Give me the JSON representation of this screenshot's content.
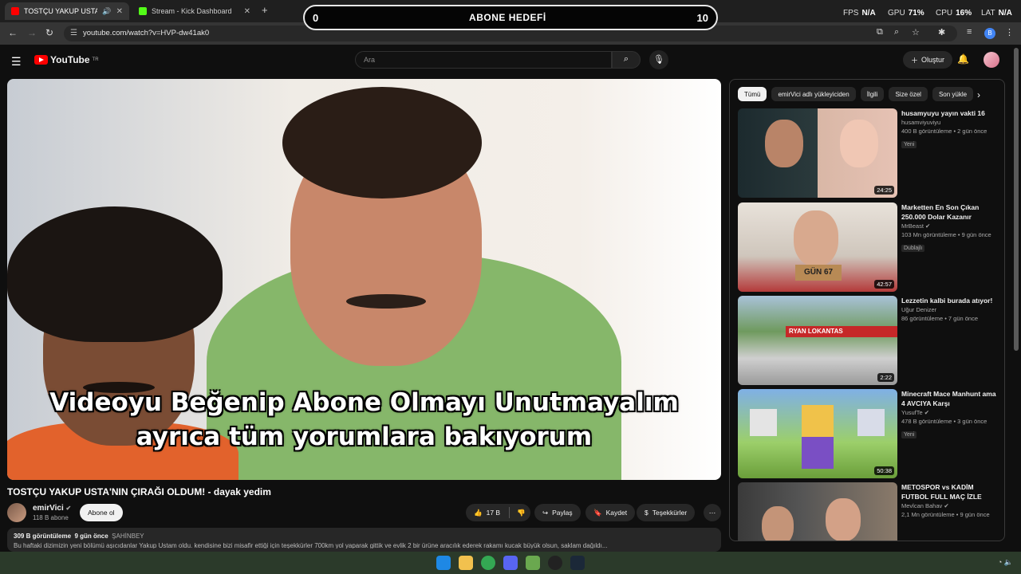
{
  "browser": {
    "tabs": [
      {
        "title": "TOSTÇU YAKUP USTA'NIN Ç",
        "active": true,
        "favicon_color": "#ff0000"
      },
      {
        "title": "Stream - Kick Dashboard",
        "active": false,
        "favicon_color": "#53fc18"
      }
    ],
    "url": "youtube.com/watch?v=HVP-dw41ak0",
    "profile_initial": "B"
  },
  "overlay": {
    "left_count": "0",
    "title": "ABONE HEDEFİ",
    "right_count": "10"
  },
  "stats": {
    "fps_label": "FPS",
    "fps_value": "N/A",
    "gpu_label": "GPU",
    "gpu_value": "71%",
    "cpu_label": "CPU",
    "cpu_value": "16%",
    "lat_label": "LAT",
    "lat_value": "N/A"
  },
  "youtube": {
    "logo_text": "YouTube",
    "region": "TR",
    "search_placeholder": "Ara",
    "create_label": "Oluştur"
  },
  "video": {
    "caption_line1": "Videoyu Beğenip Abone Olmayı Unutmayalım",
    "caption_line2": "ayrıca tüm yorumlara bakıyorum",
    "title": "TOSTÇU YAKUP USTA'NIN ÇIRAĞI OLDUM! - dayak yedim",
    "channel": "emirVici",
    "subscribers": "118 B abone",
    "subscribe_label": "Abone ol",
    "likes": "17 B",
    "share_label": "Paylaş",
    "save_label": "Kaydet",
    "thanks_label": "Teşekkürler",
    "views": "309 B görüntüleme",
    "age": "9 gün önce",
    "tag": "ŞAHİNBEY",
    "description": "Bu haftaki dizimizin yeni bölümü aşıcıdanlar Yakup Ustam oldu. kendisine bizi misafir ettiği için teşekkürler 700km yol yaparak gittik ve evlik 2 bir ürüne aracılık ederek rakamı kucak büyük olsun, saklam dağıldı..."
  },
  "chips": [
    "Tümü",
    "emirVici adlı yükleyiciden",
    "İlgili",
    "Size özel",
    "Son yükle"
  ],
  "recommendations": [
    {
      "title": "husamyuyu yayın vakti 16",
      "channel": "husamviyuviyu",
      "meta": "400 B görüntüleme • 2 gün önce",
      "badge": "Yeni",
      "duration": "24:25"
    },
    {
      "title": "Marketten En Son Çıkan 250.000 Dolar Kazanır",
      "channel": "MrBeast",
      "meta": "103 Mn görüntüleme • 9 gün önce",
      "badge": "Dublajlı",
      "duration": "42:57"
    },
    {
      "title": "Lezzetin kalbi burada atıyor!",
      "channel": "Uğur Denizer",
      "meta": "86 görüntüleme • 7 gün önce",
      "badge": "",
      "duration": "2:22"
    },
    {
      "title": "Minecraft Mace Manhunt ama 4 AVCIYA Karşı",
      "channel": "YusufTe",
      "meta": "478 B görüntüleme • 3 gün önce",
      "badge": "Yeni",
      "duration": "50:38"
    },
    {
      "title": "METOSPOR vs KADİM FUTBOL FULL MAÇ İZLE",
      "channel": "Mevlcan Bahav",
      "meta": "2,1 Mn görüntüleme • 9 gün önce",
      "badge": "",
      "duration": ""
    }
  ],
  "thumb_text": {
    "gun": "GÜN 67",
    "lokanta": "RYAN LOKANTAS"
  }
}
